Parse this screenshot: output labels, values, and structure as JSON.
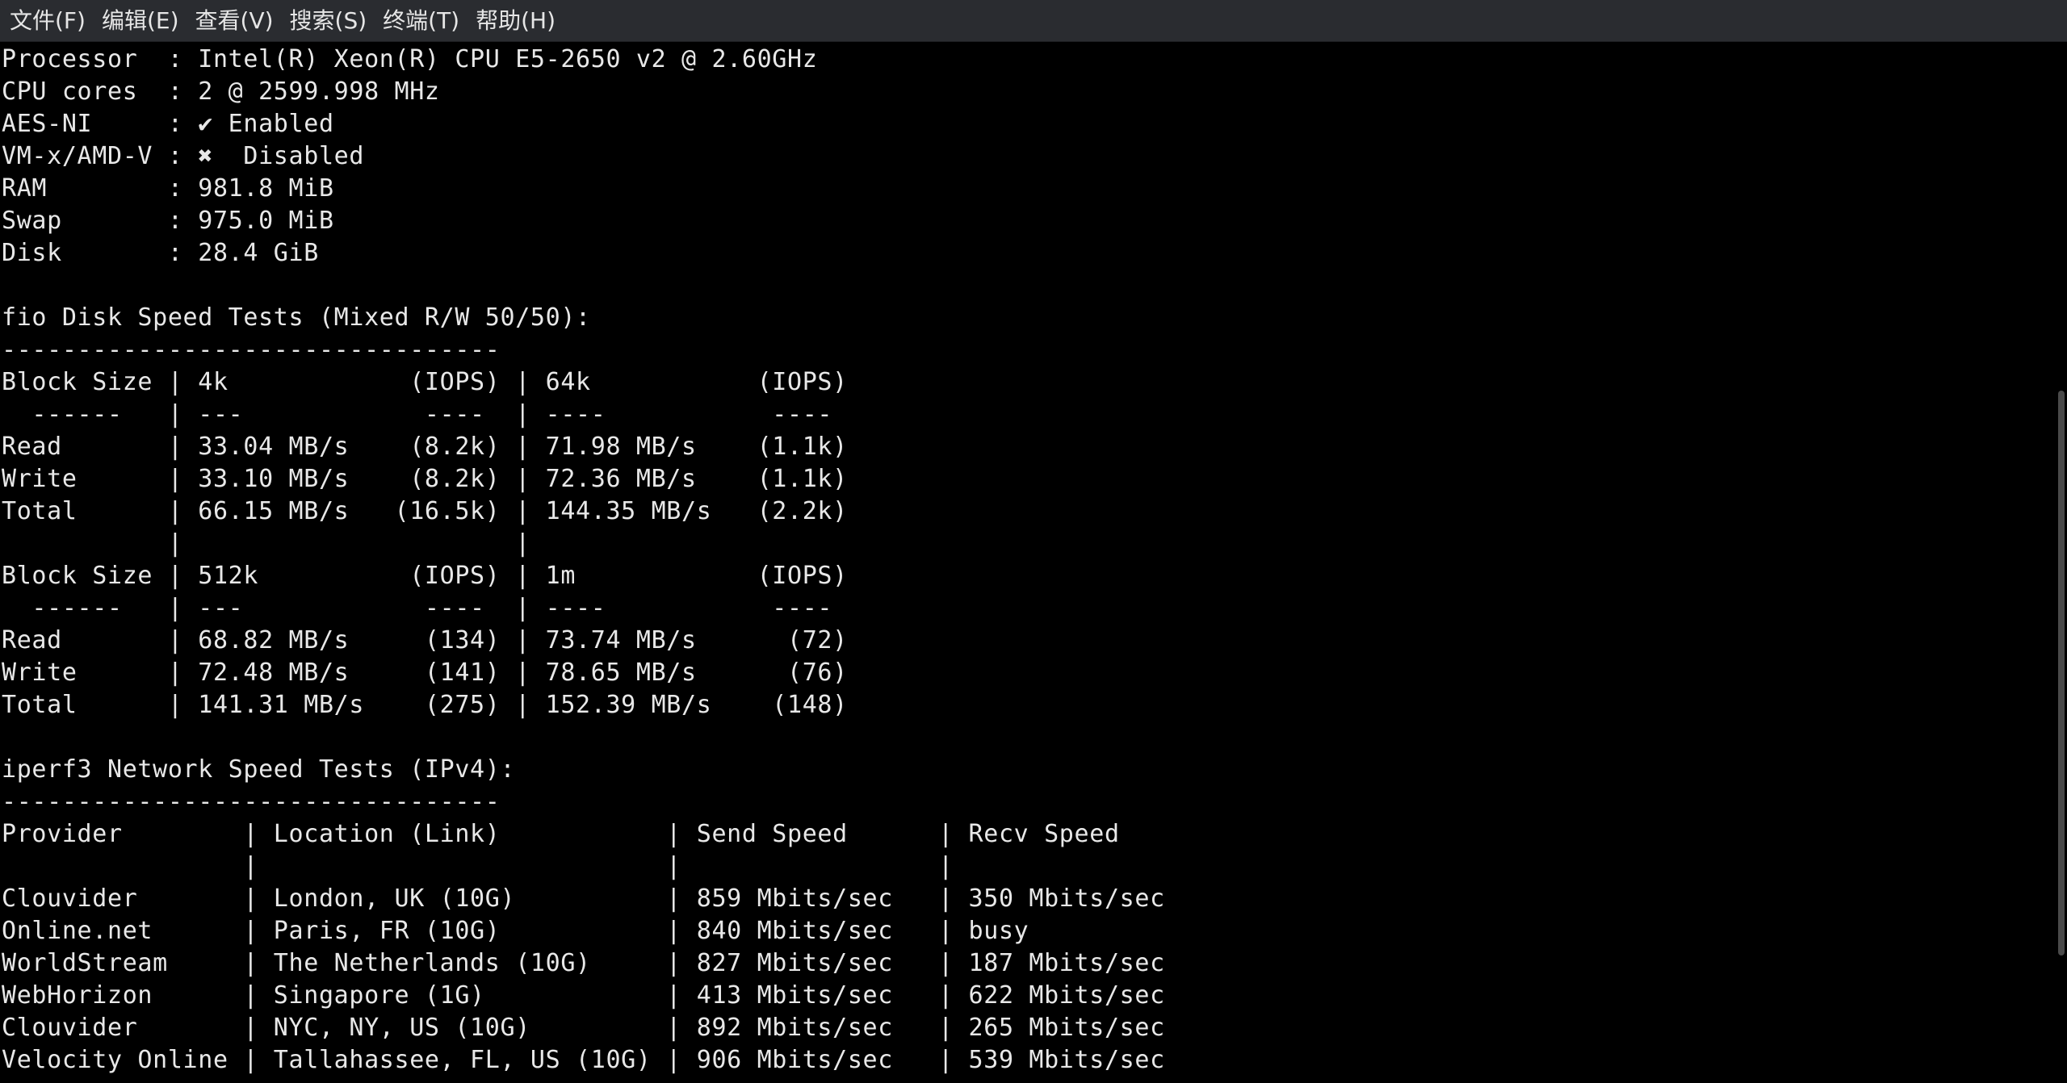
{
  "menu": [
    {
      "label": "文件(F)",
      "name": "menu-file"
    },
    {
      "label": "编辑(E)",
      "name": "menu-edit"
    },
    {
      "label": "查看(V)",
      "name": "menu-view"
    },
    {
      "label": "搜索(S)",
      "name": "menu-search"
    },
    {
      "label": "终端(T)",
      "name": "menu-terminal"
    },
    {
      "label": "帮助(H)",
      "name": "menu-help"
    }
  ],
  "terminal": {
    "lines": [
      "Processor  : Intel(R) Xeon(R) CPU E5-2650 v2 @ 2.60GHz",
      "CPU cores  : 2 @ 2599.998 MHz",
      "AES-NI     : ✔ Enabled",
      "VM-x/AMD-V : ✖  Disabled",
      "RAM        : 981.8 MiB",
      "Swap       : 975.0 MiB",
      "Disk       : 28.4 GiB",
      "",
      "fio Disk Speed Tests (Mixed R/W 50/50):",
      "---------------------------------",
      "Block Size | 4k            (IOPS) | 64k           (IOPS)",
      "  ------   | ---            ----  | ----           ----",
      "Read       | 33.04 MB/s    (8.2k) | 71.98 MB/s    (1.1k)",
      "Write      | 33.10 MB/s    (8.2k) | 72.36 MB/s    (1.1k)",
      "Total      | 66.15 MB/s   (16.5k) | 144.35 MB/s   (2.2k)",
      "           |                      |",
      "Block Size | 512k          (IOPS) | 1m            (IOPS)",
      "  ------   | ---            ----  | ----           ----",
      "Read       | 68.82 MB/s     (134) | 73.74 MB/s      (72)",
      "Write      | 72.48 MB/s     (141) | 78.65 MB/s      (76)",
      "Total      | 141.31 MB/s    (275) | 152.39 MB/s    (148)",
      "",
      "iperf3 Network Speed Tests (IPv4):",
      "---------------------------------",
      "Provider        | Location (Link)           | Send Speed      | Recv Speed",
      "                |                           |                 |",
      "Clouvider       | London, UK (10G)          | 859 Mbits/sec   | 350 Mbits/sec",
      "Online.net      | Paris, FR (10G)           | 840 Mbits/sec   | busy",
      "WorldStream     | The Netherlands (10G)     | 827 Mbits/sec   | 187 Mbits/sec",
      "WebHorizon      | Singapore (1G)            | 413 Mbits/sec   | 622 Mbits/sec",
      "Clouvider       | NYC, NY, US (10G)         | 892 Mbits/sec   | 265 Mbits/sec",
      "Velocity Online | Tallahassee, FL, US (10G) | 906 Mbits/sec   | 539 Mbits/sec"
    ]
  },
  "colors": {
    "background": "#000000",
    "text": "#e8e8e8",
    "menubar": "#2a2c30"
  }
}
